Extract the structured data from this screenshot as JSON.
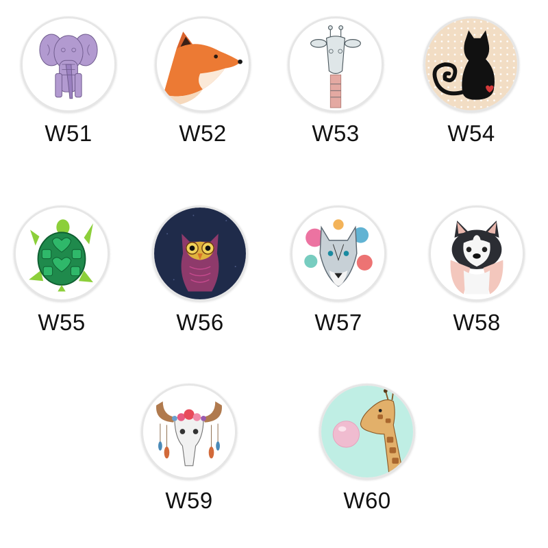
{
  "items": [
    {
      "code": "W51",
      "icon": "elephant-icon",
      "bg": "#ffffff"
    },
    {
      "code": "W52",
      "icon": "fox-icon",
      "bg": "#ffffff"
    },
    {
      "code": "W53",
      "icon": "giraffe-icon",
      "bg": "#ffffff"
    },
    {
      "code": "W54",
      "icon": "black-cat-icon",
      "bg": "#f2ddc4"
    },
    {
      "code": "W55",
      "icon": "turtle-icon",
      "bg": "#ffffff"
    },
    {
      "code": "W56",
      "icon": "owl-icon",
      "bg": "#1f2b4a"
    },
    {
      "code": "W57",
      "icon": "wolf-icon",
      "bg": "#ffffff"
    },
    {
      "code": "W58",
      "icon": "husky-icon",
      "bg": "#ffffff"
    },
    {
      "code": "W59",
      "icon": "bull-skull-dreamcatcher-icon",
      "bg": "#ffffff"
    },
    {
      "code": "W60",
      "icon": "giraffe-bubblegum-icon",
      "bg": "#bfeee4"
    }
  ]
}
